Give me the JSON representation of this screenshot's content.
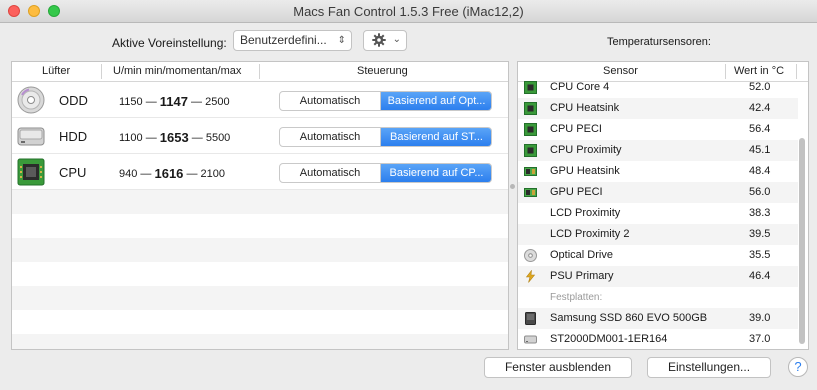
{
  "window": {
    "title": "Macs Fan Control 1.5.3 Free (iMac12,2)"
  },
  "preset": {
    "label": "Aktive Voreinstellung:",
    "value": "Benutzerdefini...",
    "chevron": "⌃⌄"
  },
  "sensors_title": "Temperatursensoren:",
  "fans": {
    "headers": {
      "fan": "Lüfter",
      "speed": "U/min min/momentan/max",
      "control": "Steuerung"
    },
    "rows": [
      {
        "name": "ODD",
        "icon": "optical-drive-icon",
        "min": "1150",
        "current": "1147",
        "max": "2500",
        "auto_label": "Automatisch",
        "based_label": "Basierend auf Opt..."
      },
      {
        "name": "HDD",
        "icon": "hard-drive-icon",
        "min": "1100",
        "current": "1653",
        "max": "5500",
        "auto_label": "Automatisch",
        "based_label": "Basierend auf ST..."
      },
      {
        "name": "CPU",
        "icon": "cpu-chip-icon",
        "min": "940",
        "current": "1616",
        "max": "2100",
        "auto_label": "Automatisch",
        "based_label": "Basierend auf CP..."
      }
    ],
    "dash": "—"
  },
  "sensors": {
    "headers": {
      "sensor": "Sensor",
      "value": "Wert in °C"
    },
    "rows": [
      {
        "name": "CPU Core 4",
        "value": "52.0",
        "icon": "cpu-chip-icon"
      },
      {
        "name": "CPU Heatsink",
        "value": "42.4",
        "icon": "cpu-chip-icon"
      },
      {
        "name": "CPU PECI",
        "value": "56.4",
        "icon": "cpu-chip-icon"
      },
      {
        "name": "CPU Proximity",
        "value": "45.1",
        "icon": "cpu-chip-icon"
      },
      {
        "name": "GPU Heatsink",
        "value": "48.4",
        "icon": "gpu-card-icon"
      },
      {
        "name": "GPU PECI",
        "value": "56.0",
        "icon": "gpu-card-icon"
      },
      {
        "name": "LCD Proximity",
        "value": "38.3",
        "icon": ""
      },
      {
        "name": "LCD Proximity 2",
        "value": "39.5",
        "icon": ""
      },
      {
        "name": "Optical Drive",
        "value": "35.5",
        "icon": "optical-drive-icon"
      },
      {
        "name": "PSU Primary",
        "value": "46.4",
        "icon": "power-bolt-icon"
      }
    ],
    "group_label": "Festplatten:",
    "disks": [
      {
        "name": "Samsung SSD 860 EVO 500GB",
        "value": "39.0",
        "icon": "ssd-icon"
      },
      {
        "name": "ST2000DM001-1ER164",
        "value": "37.0",
        "icon": "hard-drive-icon"
      }
    ]
  },
  "buttons": {
    "hide": "Fenster ausblenden",
    "settings": "Einstellungen...",
    "help": "?"
  },
  "colors": {
    "accent": "#2c7fee",
    "chip_green": "#3a9a3a"
  }
}
